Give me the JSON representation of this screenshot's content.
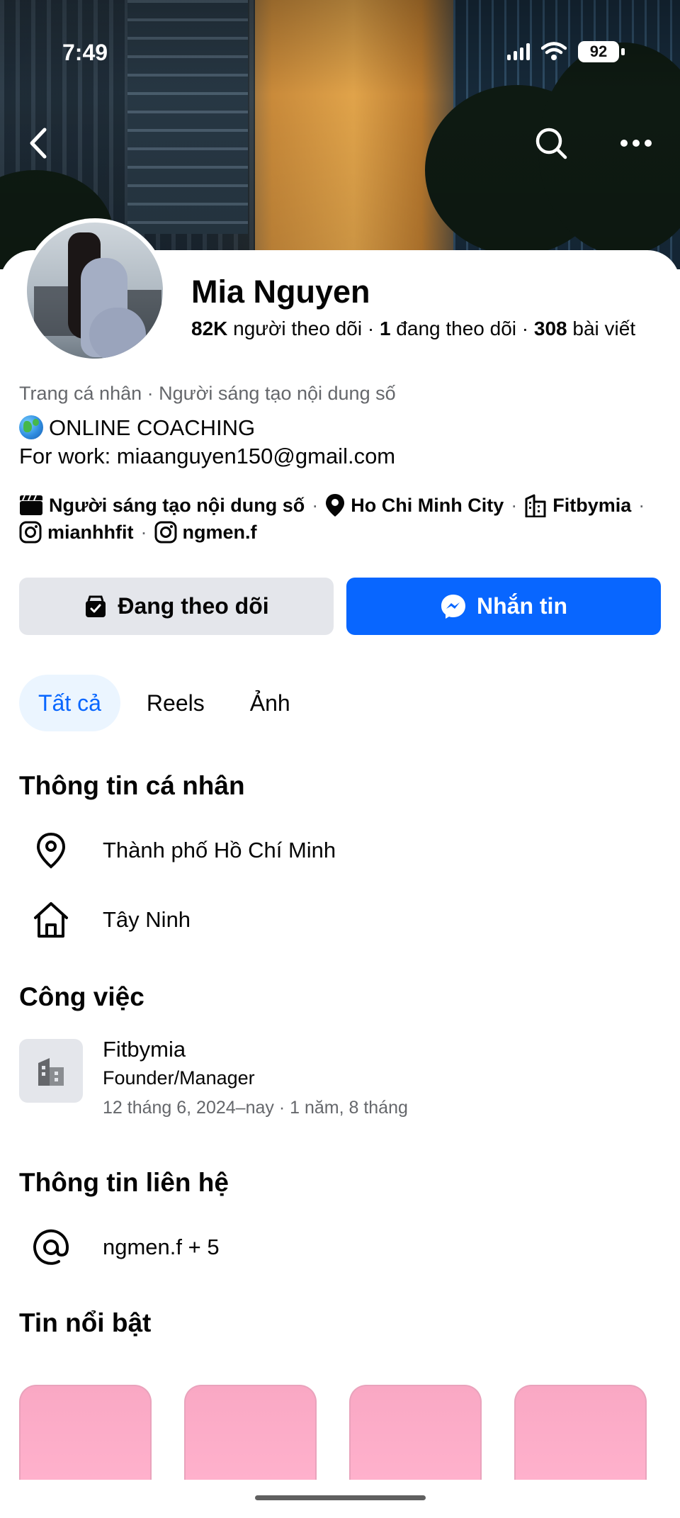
{
  "status_bar": {
    "time": "7:49",
    "battery": "92"
  },
  "profile": {
    "name": "Mia Nguyen",
    "stats": {
      "followers_count": "82K",
      "followers_label": "người theo dõi",
      "following_count": "1",
      "following_label": "đang theo dõi",
      "posts_count": "308",
      "posts_label": "bài viết",
      "separator": "·"
    },
    "subcategory": "Trang cá nhân · Người sáng tạo nội dung số",
    "bio_line1": "ONLINE COACHING",
    "bio_line2": "For work: miaanguyen150@gmail.com",
    "details": {
      "category": "Người sáng tạo nội dung số",
      "location": "Ho Chi Minh City",
      "business": "Fitbymia",
      "instagram1": "mianhhfit",
      "instagram2": "ngmen.f",
      "separator": "·"
    }
  },
  "buttons": {
    "following": "Đang theo dõi",
    "message": "Nhắn tin"
  },
  "tabs": [
    {
      "label": "Tất cả",
      "active": true
    },
    {
      "label": "Reels",
      "active": false
    },
    {
      "label": "Ảnh",
      "active": false
    }
  ],
  "personal_info": {
    "title": "Thông tin cá nhân",
    "current_city": "Thành phố Hồ Chí Minh",
    "hometown": "Tây Ninh"
  },
  "work": {
    "title": "Công việc",
    "company": "Fitbymia",
    "role": "Founder/Manager",
    "period": "12 tháng 6, 2024–nay · 1 năm, 8 tháng"
  },
  "contact": {
    "title": "Thông tin liên hệ",
    "value": "ngmen.f + 5"
  },
  "highlights": {
    "title": "Tin nổi bật"
  },
  "colors": {
    "primary": "#0866ff",
    "secondary_button": "#e4e6eb",
    "active_tab_bg": "#ebf5ff",
    "muted_text": "#65676b"
  }
}
